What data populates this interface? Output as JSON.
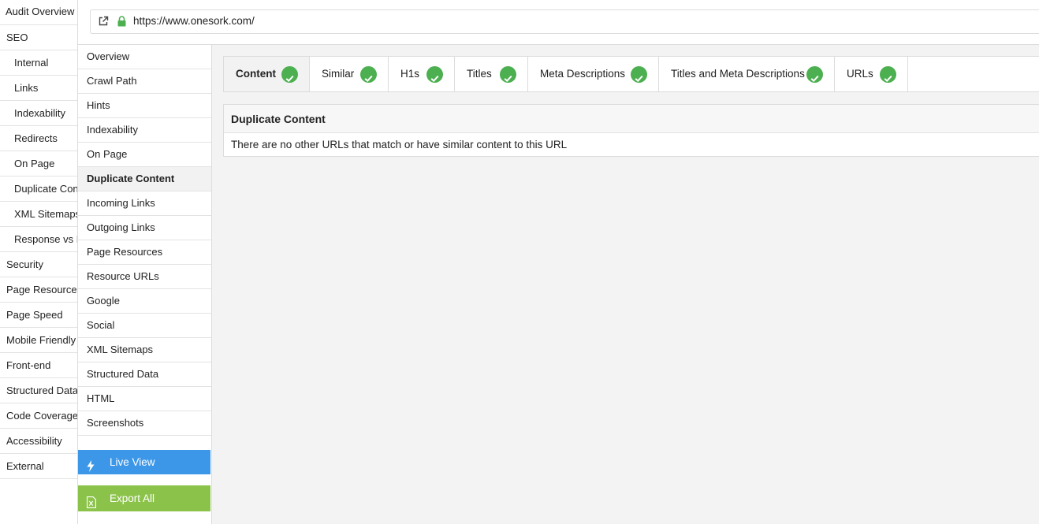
{
  "left_sidebar": {
    "items": [
      {
        "label": "Audit Overview",
        "sub": false
      },
      {
        "label": "SEO",
        "sub": false
      },
      {
        "label": "Internal",
        "sub": true
      },
      {
        "label": "Links",
        "sub": true
      },
      {
        "label": "Indexability",
        "sub": true
      },
      {
        "label": "Redirects",
        "sub": true
      },
      {
        "label": "On Page",
        "sub": true
      },
      {
        "label": "Duplicate Content",
        "sub": true
      },
      {
        "label": "XML Sitemaps",
        "sub": true
      },
      {
        "label": "Response vs Render",
        "sub": true
      },
      {
        "label": "Security",
        "sub": false
      },
      {
        "label": "Page Resources",
        "sub": false
      },
      {
        "label": "Page Speed",
        "sub": false
      },
      {
        "label": "Mobile Friendly",
        "sub": false
      },
      {
        "label": "Front-end",
        "sub": false
      },
      {
        "label": "Structured Data",
        "sub": false
      },
      {
        "label": "Code Coverage",
        "sub": false
      },
      {
        "label": "Accessibility",
        "sub": false
      },
      {
        "label": "External",
        "sub": false
      }
    ]
  },
  "url_bar": {
    "url": "https://www.onesork.com/",
    "icons": [
      "external-link-icon",
      "lock-icon"
    ]
  },
  "page_nav": {
    "items": [
      "Overview",
      "Crawl Path",
      "Hints",
      "Indexability",
      "On Page",
      "Duplicate Content",
      "Incoming Links",
      "Outgoing Links",
      "Page Resources",
      "Resource URLs",
      "Google",
      "Social",
      "XML Sitemaps",
      "Structured Data",
      "HTML",
      "Screenshots"
    ],
    "active": "Duplicate Content",
    "live_view_label": "Live View",
    "export_all_label": "Export All"
  },
  "tabs": {
    "items": [
      "Content",
      "Similar",
      "H1s",
      "Titles",
      "Meta Descriptions",
      "Titles and Meta Descriptions",
      "URLs"
    ],
    "active": "Content",
    "status_icon": "check-circle-icon"
  },
  "panel": {
    "title": "Duplicate Content",
    "message": "There are no other URLs that match or have similar content to this URL"
  },
  "colors": {
    "live_view": "#3d97e8",
    "export_all": "#8bc34a",
    "check": "#4caf50",
    "lock": "#4caf50"
  }
}
